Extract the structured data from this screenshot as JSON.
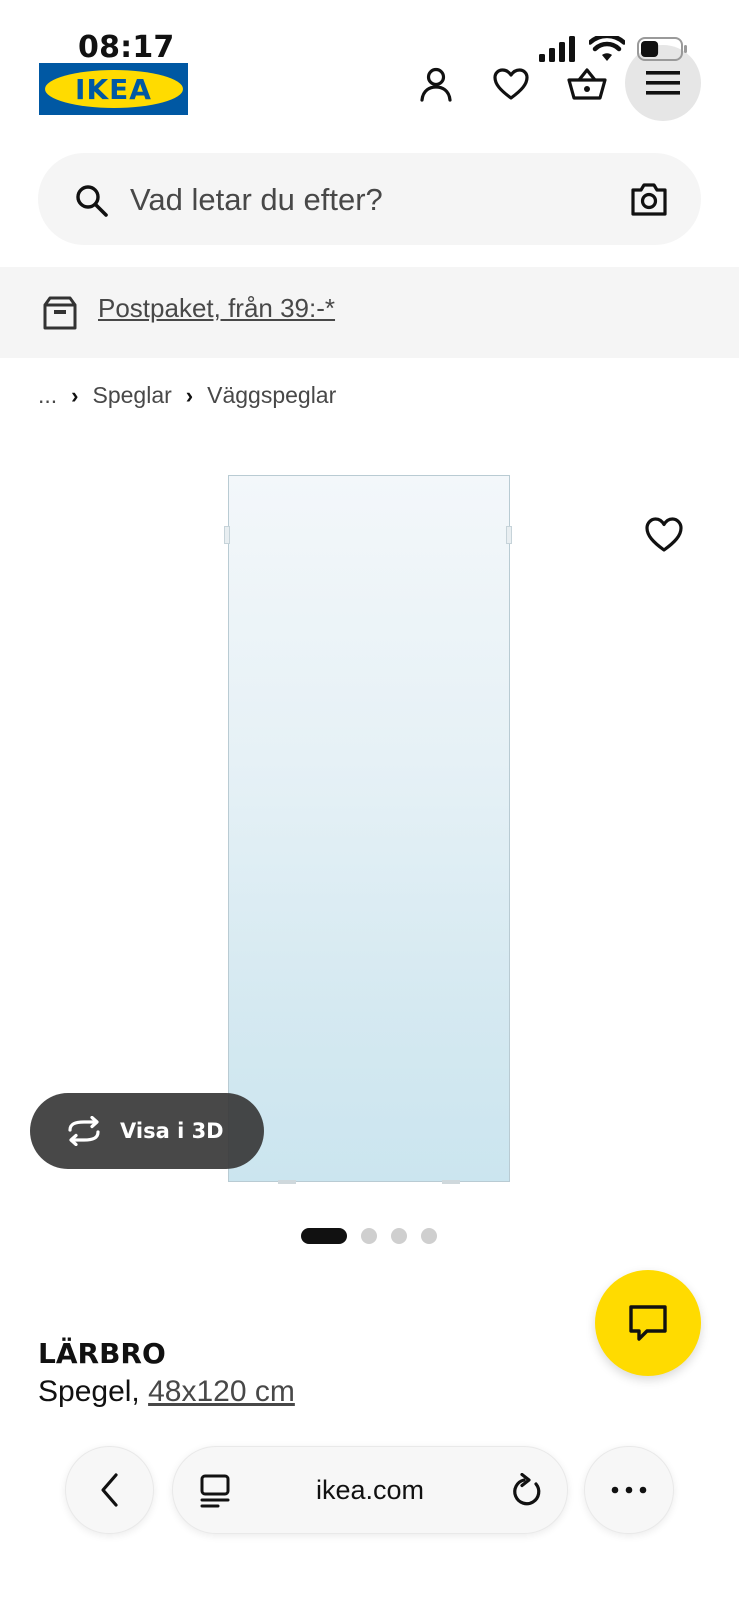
{
  "status_bar": {
    "time": "08:17",
    "signal_icon": "cellular-signal-icon",
    "wifi_icon": "wifi-icon",
    "battery_icon": "battery-icon",
    "battery_level": 0.45
  },
  "header": {
    "logo_text": "IKEA",
    "brand_colors": {
      "blue": "#0058a3",
      "yellow": "#ffdb00"
    },
    "icons": [
      "account-icon",
      "heart-icon",
      "basket-icon",
      "menu-icon"
    ]
  },
  "search": {
    "placeholder": "Vad letar du efter?",
    "value": "",
    "search_icon": "search-icon",
    "camera_icon": "camera-icon"
  },
  "promo": {
    "icon": "parcel-icon",
    "link_text": "Postpaket, från 39:-*"
  },
  "breadcrumb": {
    "items": [
      "...",
      "Speglar",
      "Väggspeglar"
    ],
    "separator": "›"
  },
  "product_gallery": {
    "favorite_icon": "heart-icon",
    "view3d_label": "Visa i 3D",
    "view3d_icon": "rotate-3d-icon",
    "dot_count": 4,
    "active_dot": 0
  },
  "chat": {
    "icon": "chat-icon",
    "color": "#ffdb00"
  },
  "product": {
    "name": "LÄRBRO",
    "type_prefix": "Spegel, ",
    "size": "48x120 cm"
  },
  "browser": {
    "url": "ikea.com",
    "back_icon": "chevron-left-icon",
    "tabs_icon": "tabs-icon",
    "reload_icon": "reload-icon",
    "more_icon": "more-icon"
  }
}
